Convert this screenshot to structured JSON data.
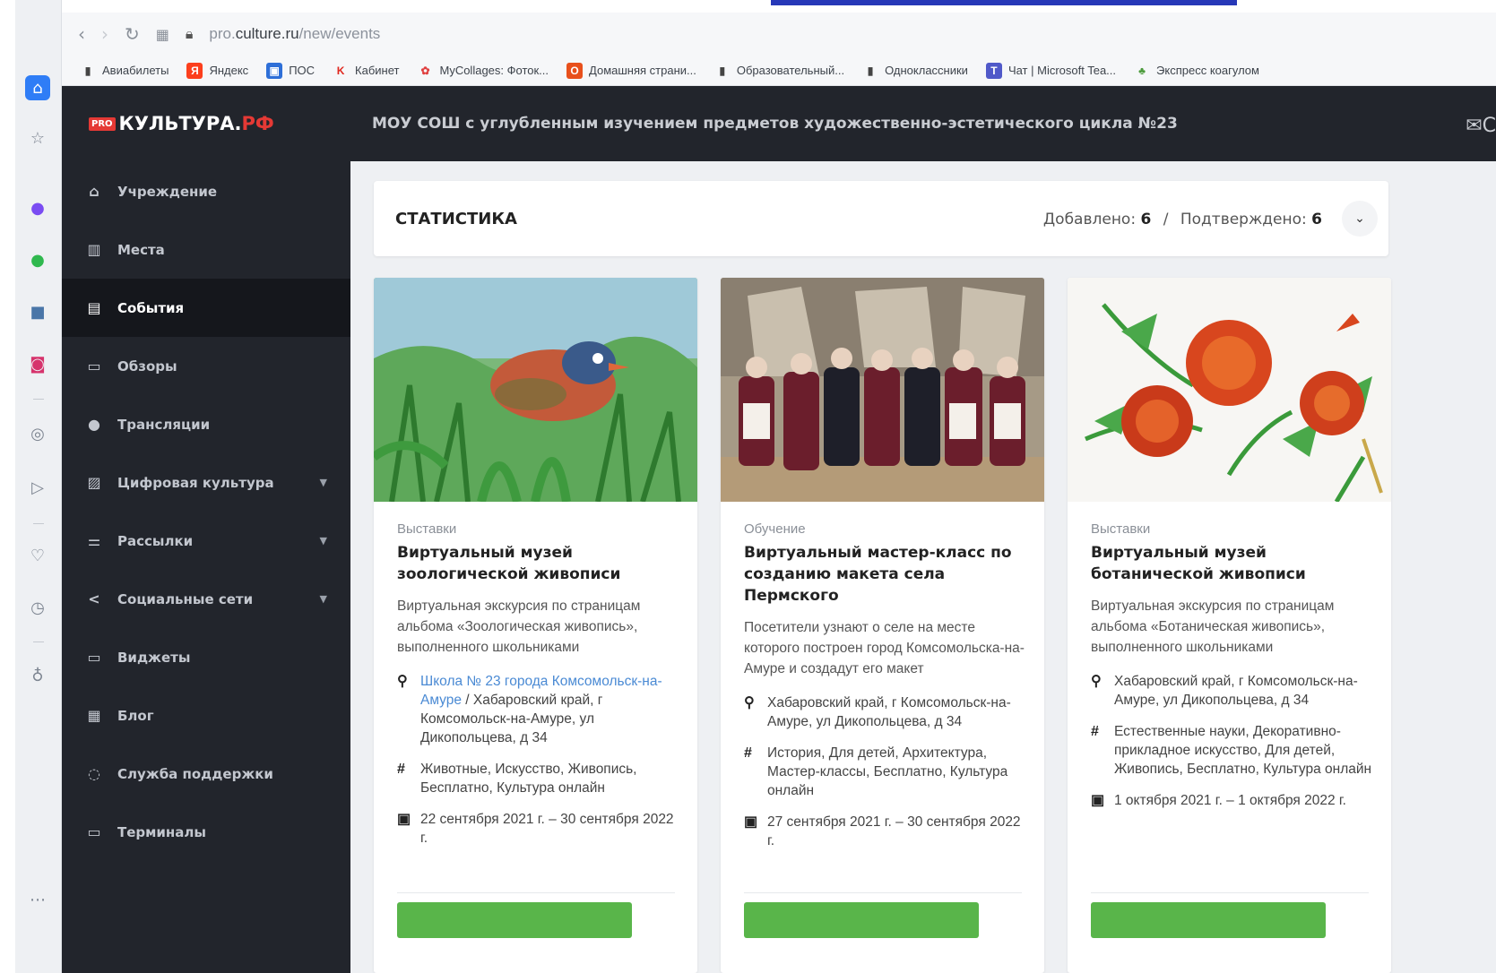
{
  "browser": {
    "url_prefix": "pro.",
    "url_domain": "culture.ru",
    "url_path": "/new/events",
    "bookmarks": [
      {
        "label": "Авиабилеты",
        "icon": "document-icon"
      },
      {
        "label": "Яндекс",
        "icon": "yandex-icon"
      },
      {
        "label": "ПОС",
        "icon": "pos-icon"
      },
      {
        "label": "Кабинет",
        "icon": "k-icon"
      },
      {
        "label": "MyCollages: Фоток...",
        "icon": "mycollages-icon"
      },
      {
        "label": "Домашняя страни...",
        "icon": "office-icon"
      },
      {
        "label": "Образовательный...",
        "icon": "document-icon"
      },
      {
        "label": "Одноклассники",
        "icon": "document-icon"
      },
      {
        "label": "Чат | Microsoft Tea...",
        "icon": "teams-icon"
      },
      {
        "label": "Экспресс коагулом",
        "icon": "plant-icon"
      }
    ]
  },
  "header": {
    "logo_pro": "PRO",
    "logo_main": "КУЛЬТУРА.",
    "logo_rf": "РФ",
    "organization": "МОУ СОШ с углубленным изучением предметов художественно-эстетического цикла №23",
    "mail_label": "С"
  },
  "sidebar": {
    "items": [
      {
        "label": "Учреждение",
        "icon": "building-icon",
        "active": false,
        "submenu": false
      },
      {
        "label": "Места",
        "icon": "places-icon",
        "active": false,
        "submenu": false
      },
      {
        "label": "События",
        "icon": "calendar-icon",
        "active": true,
        "submenu": false
      },
      {
        "label": "Обзоры",
        "icon": "chat-icon",
        "active": false,
        "submenu": false
      },
      {
        "label": "Трансляции",
        "icon": "broadcast-icon",
        "active": false,
        "submenu": false
      },
      {
        "label": "Цифровая культура",
        "icon": "image-icon",
        "active": false,
        "submenu": true
      },
      {
        "label": "Рассылки",
        "icon": "mailing-icon",
        "active": false,
        "submenu": true
      },
      {
        "label": "Социальные сети",
        "icon": "share-icon",
        "active": false,
        "submenu": true
      },
      {
        "label": "Виджеты",
        "icon": "widget-icon",
        "active": false,
        "submenu": false
      },
      {
        "label": "Блог",
        "icon": "blog-icon",
        "active": false,
        "submenu": false
      },
      {
        "label": "Служба поддержки",
        "icon": "support-icon",
        "active": false,
        "submenu": false
      },
      {
        "label": "Терминалы",
        "icon": "terminal-icon",
        "active": false,
        "submenu": false
      }
    ]
  },
  "stats": {
    "title": "СТАТИСТИКА",
    "added_label": "Добавлено:",
    "added_value": "6",
    "separator": "/",
    "confirmed_label": "Подтверждено:",
    "confirmed_value": "6"
  },
  "events": [
    {
      "category": "Выставки",
      "title": "Виртуальный музей зоологической живописи",
      "description": "Виртуальная экскурсия по страницам альбома «Зоологическая живопись», выполненного школьниками",
      "place_link": "Школа № 23 города Комсомольск-на-Амуре",
      "address": " / Хабаровский край, г Комсомольск-на-Амуре, ул Дикопольцева, д 34",
      "tags": "Животные, Искусство, Живопись, Бесплатно, Культура онлайн",
      "dates": "22 сентября 2021 г. – 30 сентября 2022 г."
    },
    {
      "category": "Обучение",
      "title": "Виртуальный мастер-класс по созданию макета села Пермского",
      "description": "Посетители узнают о селе на месте которого построен город Комсомольска-на-Амуре и создадут его макет",
      "place_link": "",
      "address": "Хабаровский край, г Комсомольск-на-Амуре, ул Дикопольцева, д 34",
      "tags": "История, Для детей, Архитектура, Мастер-классы, Бесплатно, Культура онлайн",
      "dates": "27 сентября 2021 г. – 30 сентября 2022 г."
    },
    {
      "category": "Выставки",
      "title": "Виртуальный музей ботанической живописи",
      "description": "Виртуальная экскурсия по страницам альбома «Ботаническая живопись», выполненного школьниками",
      "place_link": "",
      "address": "Хабаровский край, г Комсомольск-на-Амуре, ул Дикопольцева, д 34",
      "tags": "Естественные науки, Декоративно-прикладное искусство, Для детей, Живопись, Бесплатно, Культура онлайн",
      "dates": "1 октября 2021 г. – 1 октября 2022 г."
    }
  ],
  "colors": {
    "sidebar_bg": "#22252c",
    "sidebar_active": "#15171c",
    "accent_red": "#e53935",
    "button_green": "#59b54a",
    "link_blue": "#4a8ad4"
  }
}
